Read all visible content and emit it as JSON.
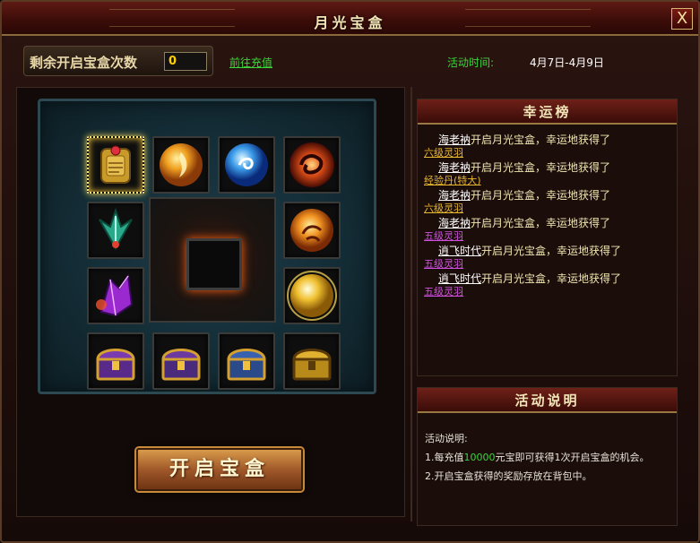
{
  "window": {
    "title": "月光宝盒",
    "close_label": "X"
  },
  "header": {
    "count_label": "剩余开启宝盒次数",
    "count_value": "0",
    "recharge_link": "前往充值",
    "time_label": "活动时间:",
    "time_value": "4月7日-4月9日"
  },
  "board": {
    "items": [
      {
        "name": "golden-scroll-amulet",
        "selected": true
      },
      {
        "name": "fire-orb"
      },
      {
        "name": "water-orb"
      },
      {
        "name": "flame-ring-orb"
      },
      {
        "name": "jade-leaf-crystal"
      },
      {
        "name": "sun-orb"
      },
      {
        "name": "purple-crystal"
      },
      {
        "name": "golden-light-orb"
      },
      {
        "name": "purple-treasure-chest-1"
      },
      {
        "name": "purple-treasure-chest-2"
      },
      {
        "name": "blue-treasure-chest"
      },
      {
        "name": "golden-treasure-chest"
      }
    ]
  },
  "open_button": "开启宝盒",
  "rank": {
    "title": "幸运榜",
    "entries": [
      {
        "user": "海老衲",
        "text": "开启月光宝盒，幸运地获得了",
        "prize": "六级灵羽",
        "prize_color": "#e8b830"
      },
      {
        "user": "海老衲",
        "text": "开启月光宝盒，幸运地获得了",
        "prize": "经验丹(特大)",
        "prize_color": "#e8b830"
      },
      {
        "user": "海老衲",
        "text": "开启月光宝盒，幸运地获得了",
        "prize": "六级灵羽",
        "prize_color": "#e8b830"
      },
      {
        "user": "海老衲",
        "text": "开启月光宝盒，幸运地获得了",
        "prize": "五级灵羽",
        "prize_color": "#d050e0"
      },
      {
        "user": "逍飞时代",
        "text": "开启月光宝盒，幸运地获得了",
        "prize": "五级灵羽",
        "prize_color": "#d050e0"
      },
      {
        "user": "逍飞时代",
        "text": "开启月光宝盒，幸运地获得了",
        "prize": "五级灵羽",
        "prize_color": "#d050e0"
      }
    ]
  },
  "info": {
    "title": "活动说明",
    "heading": "活动说明:",
    "line1_prefix": "1.每充值",
    "line1_amount": "10000",
    "line1_suffix": "元宝即可获得1次开启宝盒的机会。",
    "line2": "2.开启宝盒获得的奖励存放在背包中。"
  }
}
